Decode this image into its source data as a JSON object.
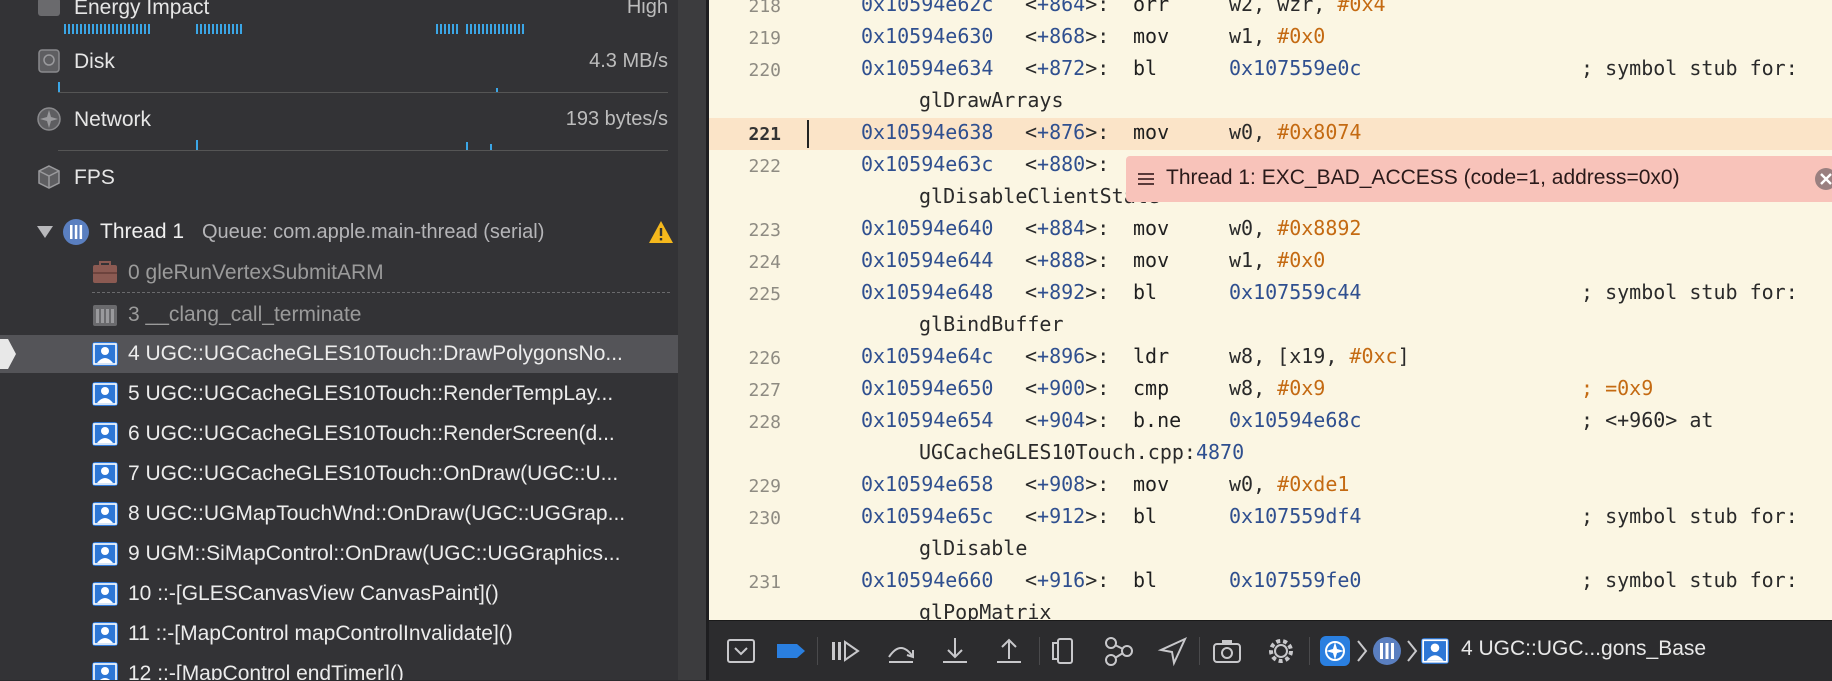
{
  "gauges": [
    {
      "label": "Energy Impact",
      "value": "High"
    },
    {
      "label": "Disk",
      "value": "4.3 MB/s"
    },
    {
      "label": "Network",
      "value": "193 bytes/s"
    },
    {
      "label": "FPS",
      "value": ""
    }
  ],
  "thread": {
    "name": "Thread 1",
    "queue": "Queue: com.apple.main-thread (serial)"
  },
  "frames": [
    {
      "text": "0 gleRunVertexSubmitARM",
      "kind": "lib",
      "dim": true
    },
    {
      "text": "3 __clang_call_terminate",
      "kind": "lib",
      "dim": true
    },
    {
      "text": "4 UGC::UGCacheGLES10Touch::DrawPolygonsNo...",
      "kind": "user",
      "selected": true
    },
    {
      "text": "5 UGC::UGCacheGLES10Touch::RenderTempLay...",
      "kind": "user"
    },
    {
      "text": "6 UGC::UGCacheGLES10Touch::RenderScreen(d...",
      "kind": "user"
    },
    {
      "text": "7 UGC::UGCacheGLES10Touch::OnDraw(UGC::U...",
      "kind": "user"
    },
    {
      "text": "8 UGC::UGMapTouchWnd::OnDraw(UGC::UGGrap...",
      "kind": "user"
    },
    {
      "text": "9 UGM::SiMapControl::OnDraw(UGC::UGGraphics...",
      "kind": "user"
    },
    {
      "text": "10 ::-[GLESCanvasView CanvasPaint]()",
      "kind": "user"
    },
    {
      "text": "11 ::-[MapControl mapControlInvalidate]()",
      "kind": "user"
    },
    {
      "text": "12 ::-[MapControl endTimer]()",
      "kind": "user"
    }
  ],
  "code_lines": [
    {
      "n": "218",
      "addr": "0x10594e62c",
      "off": "+864",
      "op": "orr",
      "args": "w2, wzr, ",
      "imm": "#0x4",
      "comment": ""
    },
    {
      "n": "219",
      "addr": "0x10594e630",
      "off": "+868",
      "op": "mov",
      "args": "w1, ",
      "imm": "#0x0",
      "comment": ""
    },
    {
      "n": "220",
      "addr": "0x10594e634",
      "off": "+872",
      "op": "bl",
      "target": "0x107559e0c",
      "comment": "; symbol stub for:",
      "cont": "glDrawArrays"
    },
    {
      "n": "221",
      "addr": "0x10594e638",
      "off": "+876",
      "op": "mov",
      "args": "w0, ",
      "imm": "#0x8074",
      "comment": "",
      "current": true
    },
    {
      "n": "222",
      "addr": "0x10594e63c",
      "off": "+880",
      "op": "",
      "args": "",
      "imm": "",
      "comment": "",
      "cont": "glDisableClientState"
    },
    {
      "n": "223",
      "addr": "0x10594e640",
      "off": "+884",
      "op": "mov",
      "args": "w0, ",
      "imm": "#0x8892",
      "comment": ""
    },
    {
      "n": "224",
      "addr": "0x10594e644",
      "off": "+888",
      "op": "mov",
      "args": "w1, ",
      "imm": "#0x0",
      "comment": ""
    },
    {
      "n": "225",
      "addr": "0x10594e648",
      "off": "+892",
      "op": "bl",
      "target": "0x107559c44",
      "comment": "; symbol stub for:",
      "cont": "glBindBuffer"
    },
    {
      "n": "226",
      "addr": "0x10594e64c",
      "off": "+896",
      "op": "ldr",
      "args": "w8, [x19, ",
      "imm": "#0xc",
      "tail": "]",
      "comment": ""
    },
    {
      "n": "227",
      "addr": "0x10594e650",
      "off": "+900",
      "op": "cmp",
      "args": "w8, ",
      "imm": "#0x9",
      "comment": "",
      "ocomment": "; =0x9"
    },
    {
      "n": "228",
      "addr": "0x10594e654",
      "off": "+904",
      "op": "b.ne",
      "target": "0x10594e68c",
      "comment": "; <+960> at",
      "cont": "UGCacheGLES10Touch.cpp:",
      "contnum": "4870"
    },
    {
      "n": "229",
      "addr": "0x10594e658",
      "off": "+908",
      "op": "mov",
      "args": "w0, ",
      "imm": "#0xde1",
      "comment": ""
    },
    {
      "n": "230",
      "addr": "0x10594e65c",
      "off": "+912",
      "op": "bl",
      "target": "0x107559df4",
      "comment": "; symbol stub for:",
      "cont": "glDisable"
    },
    {
      "n": "231",
      "addr": "0x10594e660",
      "off": "+916",
      "op": "bl",
      "target": "0x107559fe0",
      "comment": "; symbol stub for:",
      "cont": "glPopMatrix"
    }
  ],
  "error": {
    "text": "Thread 1: EXC_BAD_ACCESS (code=1, address=0x0)"
  },
  "breadcrumb": {
    "text": "4 UGC::UGC...gons_Base"
  },
  "colors": {
    "accent": "#2a7fe0",
    "error_bg": "#f8c3ba",
    "current_line": "#fbe4c8"
  }
}
